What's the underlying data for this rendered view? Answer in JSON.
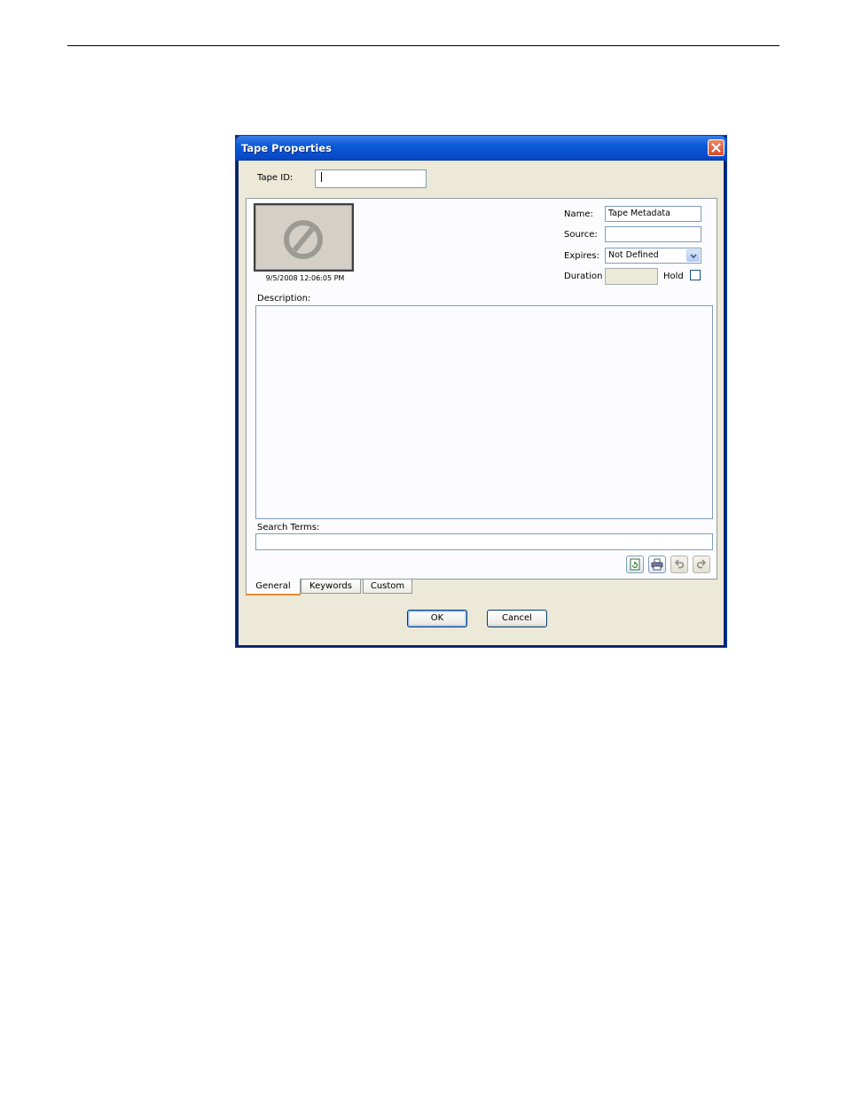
{
  "window": {
    "title": "Tape Properties"
  },
  "tape_id": {
    "label": "Tape ID:",
    "value": ""
  },
  "thumbnail": {
    "timestamp": "9/5/2008 12:06:05 PM"
  },
  "fields": {
    "name": {
      "label": "Name:",
      "value": "Tape Metadata"
    },
    "source": {
      "label": "Source:",
      "value": ""
    },
    "expires": {
      "label": "Expires:",
      "value": "Not Defined"
    },
    "duration": {
      "label": "Duration",
      "value": ""
    },
    "hold": {
      "label": "Hold",
      "checked": false
    }
  },
  "description": {
    "label": "Description:",
    "value": ""
  },
  "search_terms": {
    "label": "Search Terms:",
    "value": ""
  },
  "toolbar": {
    "icons": [
      "refresh-icon",
      "print-icon",
      "undo-icon",
      "redo-icon"
    ]
  },
  "tabs": [
    {
      "label": "General",
      "active": true
    },
    {
      "label": "Keywords",
      "active": false
    },
    {
      "label": "Custom",
      "active": false
    }
  ],
  "buttons": {
    "ok": "OK",
    "cancel": "Cancel"
  },
  "colors": {
    "titlebar": "#0a5ad8",
    "dialog_bg": "#ece9d8",
    "active_tab_accent": "#e68b2c",
    "close_button": "#d6492a"
  }
}
